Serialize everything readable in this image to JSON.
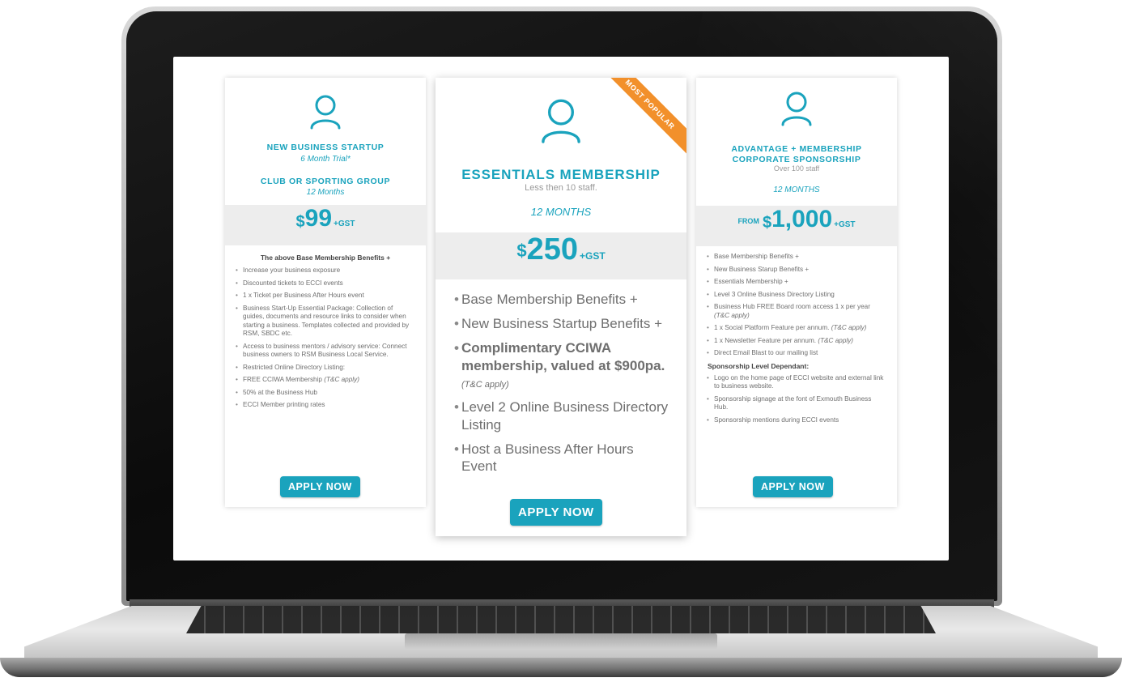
{
  "cards": {
    "left": {
      "title1": "NEW BUSINESS STARTUP",
      "sub1": "6 Month Trial*",
      "title2": "CLUB OR SPORTING GROUP",
      "sub2": "12 Months",
      "price": {
        "currency": "$",
        "amount": "99",
        "gst": "+GST"
      },
      "heading": "The above Base Membership Benefits +",
      "benefits": [
        "Increase your business exposure",
        "Discounted tickets to ECCI events",
        "1 x Ticket per Business After Hours event",
        "Business Start-Up Essential Package: Collection of guides, documents and resource links to consider when starting a business. Templates collected and provided by RSM, SBDC etc.",
        "Access to business mentors / advisory service: Connect business owners to RSM Business Local Service.",
        "Restricted Online Directory Listing:",
        "FREE CCIWA Membership",
        "50% at the Business Hub",
        "ECCI Member printing rates"
      ],
      "tc": "(T&C apply)",
      "apply": "APPLY NOW"
    },
    "mid": {
      "ribbon": "MOST POPULAR",
      "title": "ESSENTIALS MEMBERSHIP",
      "staff": "Less then 10 staff.",
      "period": "12 MONTHS",
      "price": {
        "currency": "$",
        "amount": "250",
        "gst": "+GST"
      },
      "benefits": [
        "Base Membership Benefits +",
        "New Business Startup Benefits +",
        "Complimentary CCIWA membership, valued at $900pa.",
        "Level 2 Online Business Directory Listing",
        "Host a Business After Hours Event"
      ],
      "tc": "(T&C apply)",
      "apply": "APPLY NOW"
    },
    "right": {
      "title1": "ADVANTAGE + MEMBERSHIP",
      "title2": "CORPORATE SPONSORSHIP",
      "staff": "Over 100 staff",
      "period": "12 MONTHS",
      "price": {
        "from": "FROM",
        "currency": "$",
        "amount": "1,000",
        "gst": "+GST"
      },
      "benefits": [
        "Base Membership Benefits +",
        "New Business Starup Benefits +",
        "Essentials Membership +",
        "Level 3 Online Business Directory Listing",
        "Business Hub FREE Board room access 1 x per year",
        "1 x Social Platform Feature per annum.",
        "1 x Newsletter Feature per annum.",
        "Direct Email Blast to our mailing list"
      ],
      "tc": "(T&C apply)",
      "section_label": "Sponsorship Level Dependant:",
      "sponsorship": [
        "Logo on the home page of ECCI website and external link to business website.",
        "Sponsorship signage at the font of Exmouth Business Hub.",
        "Sponsorship mentions during ECCI events"
      ],
      "apply": "APPLY NOW"
    }
  },
  "icon": "user-outline-icon",
  "colors": {
    "accent": "#1aa3bd",
    "ribbon": "#f2902b",
    "band": "#ededed"
  }
}
